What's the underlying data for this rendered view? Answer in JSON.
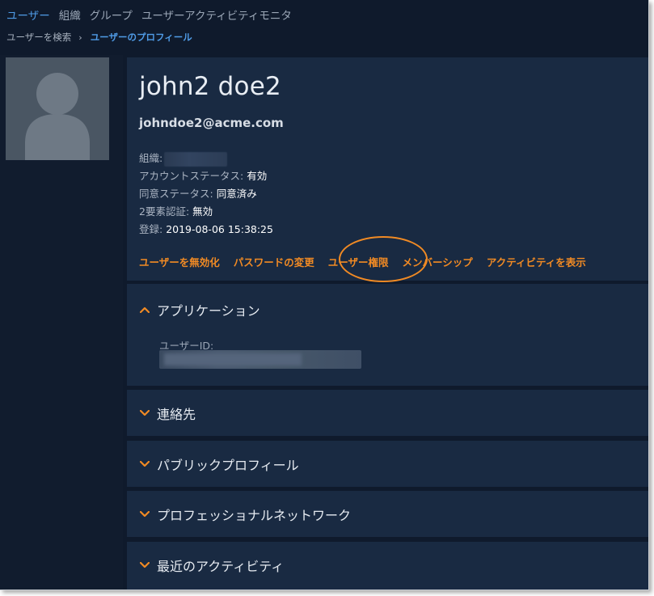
{
  "nav": {
    "tabs": [
      {
        "label": "ユーザー",
        "active": true
      },
      {
        "label": "組織",
        "active": false
      },
      {
        "label": "グループ",
        "active": false
      },
      {
        "label": "ユーザーアクティビティモニタ",
        "active": false
      }
    ]
  },
  "breadcrumb": {
    "items": [
      "ユーザーを検索",
      "ユーザーのプロフィール"
    ],
    "separator": "›"
  },
  "profile": {
    "name": "john2 doe2",
    "email": "johndoe2@acme.com",
    "info": {
      "org_label": "組織:",
      "account_status_label": "アカウントステータス:",
      "account_status_value": "有効",
      "consent_status_label": "同意ステータス:",
      "consent_status_value": "同意済み",
      "two_factor_label": "2要素認証:",
      "two_factor_value": "無効",
      "registered_label": "登録:",
      "registered_value": "2019-08-06 15:38:25"
    },
    "actions": [
      "ユーザーを無効化",
      "パスワードの変更",
      "ユーザー権限",
      "メンバーシップ",
      "アクティビティを表示"
    ]
  },
  "sections": {
    "applications": {
      "title": "アプリケーション",
      "expanded": true,
      "user_id_label": "ユーザーID:"
    },
    "contacts": {
      "title": "連絡先",
      "expanded": false
    },
    "public_profile": {
      "title": "パブリックプロフィール",
      "expanded": false
    },
    "professional_network": {
      "title": "プロフェッショナルネットワーク",
      "expanded": false
    },
    "recent_activity": {
      "title": "最近のアクティビティ",
      "expanded": false
    }
  },
  "colors": {
    "background": "#0f1a2c",
    "panel": "#192a42",
    "accent_blue": "#4f9be6",
    "accent_orange": "#f08a24",
    "text": "#e6ebf1"
  },
  "icons": {
    "avatar": "user-silhouette-icon",
    "expanded": "chevron-up-icon",
    "collapsed": "chevron-down-icon"
  }
}
